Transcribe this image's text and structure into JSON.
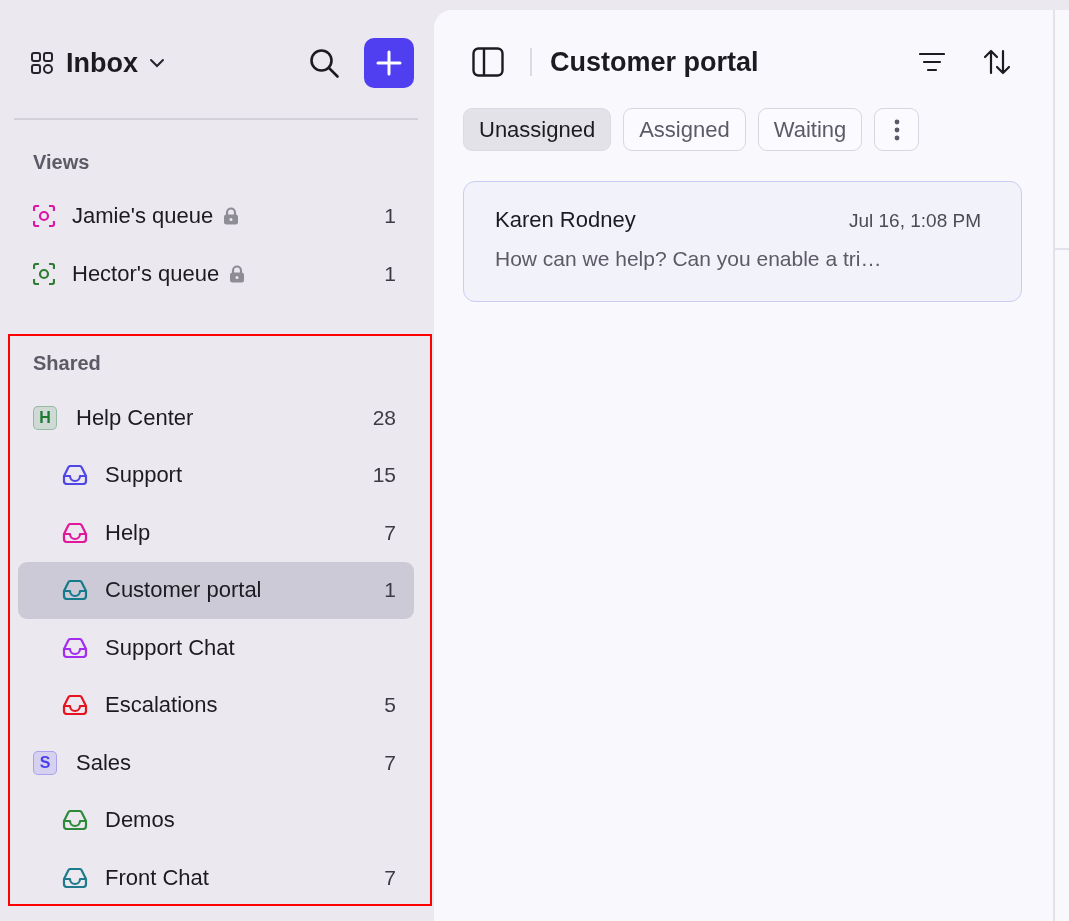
{
  "sidebar": {
    "title": "Inbox",
    "views_heading": "Views",
    "views": [
      {
        "label": "Jamie's queue",
        "locked": true,
        "count": "1",
        "color": "#d916a8"
      },
      {
        "label": "Hector's queue",
        "locked": true,
        "count": "1",
        "color": "#2e7d32"
      }
    ],
    "shared_heading": "Shared",
    "teams": [
      {
        "badge": "H",
        "name": "Help Center",
        "count": "28",
        "color": "#1f7a33",
        "selected": false,
        "children": [
          {
            "name": "Support",
            "count": "15",
            "color": "#4f46e5",
            "selected": false
          },
          {
            "name": "Help",
            "count": "7",
            "color": "#e0169b",
            "selected": false
          },
          {
            "name": "Customer portal",
            "count": "1",
            "color": "#157a8c",
            "selected": true
          },
          {
            "name": "Support Chat",
            "color": "#a22cf0",
            "selected": false
          },
          {
            "name": "Escalations",
            "count": "5",
            "color": "#e5141e",
            "selected": false
          }
        ]
      },
      {
        "badge": "S",
        "name": "Sales",
        "count": "7",
        "color": "#4a3ff0",
        "selected": false,
        "children": [
          {
            "name": "Demos",
            "color": "#2e8a3a",
            "selected": false
          },
          {
            "name": "Front Chat",
            "count": "7",
            "color": "#1e7a8c",
            "selected": false
          }
        ]
      }
    ]
  },
  "conversation_list": {
    "title": "Customer portal",
    "filters": [
      {
        "label": "Unassigned",
        "selected": true
      },
      {
        "label": "Assigned",
        "selected": false
      },
      {
        "label": "Waiting",
        "selected": false
      }
    ],
    "conversations": [
      {
        "name": "Karen Rodney",
        "time": "Jul 16, 1:08 PM",
        "preview": "How can we help? Can you enable a tri…"
      }
    ]
  }
}
